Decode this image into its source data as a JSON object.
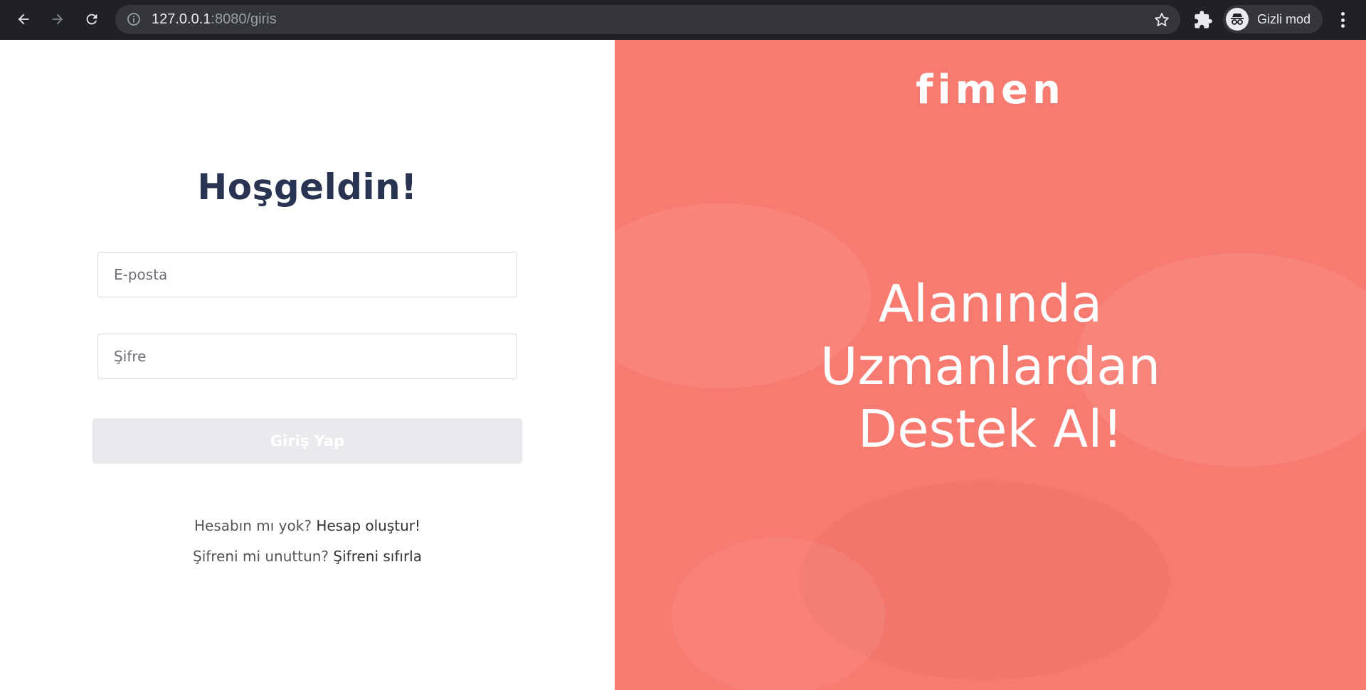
{
  "browser": {
    "url_host": "127.0.0.1",
    "url_rest": ":8080/giris",
    "profile_label": "Gizli mod",
    "icons": [
      "back-arrow-icon",
      "forward-arrow-icon",
      "reload-icon",
      "info-icon",
      "star-icon",
      "puzzle-extension-icon",
      "incognito-icon",
      "more-vertical-icon"
    ]
  },
  "login": {
    "title": "Hoşgeldin!",
    "email_placeholder": "E-posta",
    "password_placeholder": "Şifre",
    "submit_label": "Giriş Yap",
    "signup_prompt": "Hesabın mı yok?",
    "signup_link": "Hesap oluştur!",
    "reset_prompt": "Şifreni mi unuttun?",
    "reset_link": "Şifreni sıfırla"
  },
  "promo": {
    "logo": "fimen",
    "headline_line1": "Alanında",
    "headline_line2": "Uzmanlardan",
    "headline_line3": "Destek Al!"
  },
  "colors": {
    "brand_coral": "#f87b71",
    "title_navy": "#283452",
    "button_disabled": "#e9eaee",
    "chrome_dark": "#202124"
  }
}
